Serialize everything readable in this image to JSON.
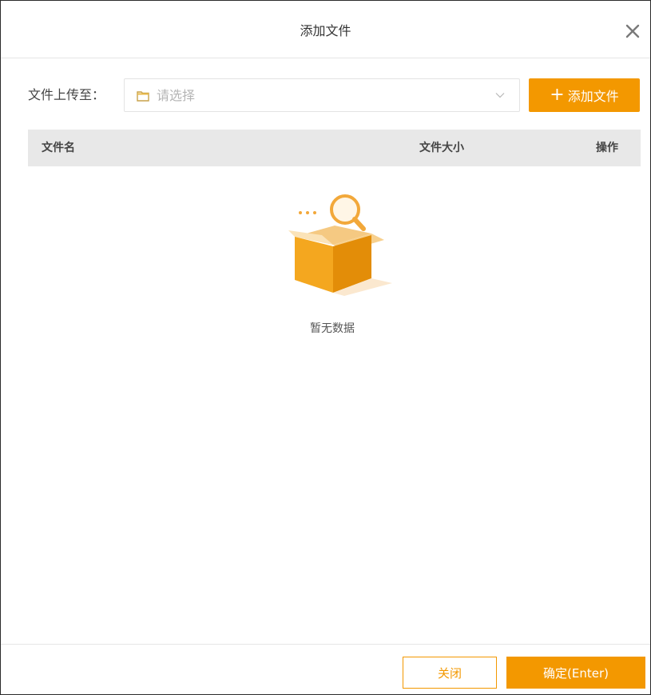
{
  "dialog": {
    "title": "添加文件"
  },
  "upload": {
    "label": "文件上传至：",
    "placeholder": "请选择",
    "add_button_label": "添加文件"
  },
  "table": {
    "columns": [
      "文件名",
      "文件大小",
      "操作"
    ]
  },
  "empty_state": {
    "text": "暂无数据"
  },
  "footer": {
    "cancel_label": "关闭",
    "confirm_label": "确定(Enter)"
  },
  "colors": {
    "accent": "#f39800",
    "header_bg": "#e8e8e8",
    "border": "#e6e6e6"
  },
  "icons": {
    "close": "close-icon",
    "folder": "folder-icon",
    "chevron": "chevron-down-icon",
    "plus": "plus-icon",
    "empty": "empty-box-icon"
  }
}
